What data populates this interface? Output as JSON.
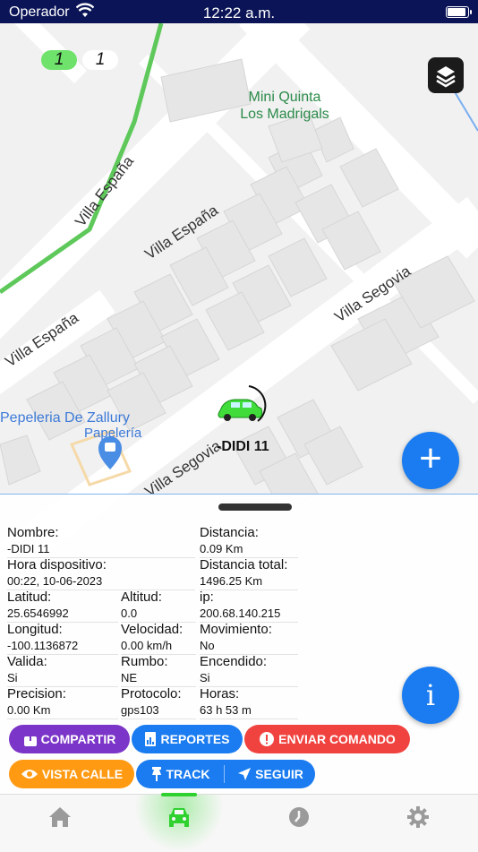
{
  "status_bar": {
    "carrier": "Operador",
    "time": "12:22 a.m.",
    "battery_level": 0.9
  },
  "map": {
    "counters": {
      "green": "1",
      "white": "1"
    },
    "poi": {
      "line1": "Mini Quinta",
      "line2": "Los Madrigals"
    },
    "shop": {
      "name": "Pepeleria De Zallury",
      "category": "Papelería"
    },
    "streets": [
      "Villa España",
      "Villa España",
      "Villa España",
      "Villa Segovia",
      "Villa Segovia"
    ],
    "vehicle_label": "-DIDI 11",
    "plus_label": "+",
    "info_label": "i"
  },
  "colors": {
    "accent": "#1a7cf0",
    "route": "#5ec95a",
    "vehicle": "#3fdc3a"
  },
  "details": {
    "nombre_lbl": "Nombre:",
    "nombre_val": "-DIDI 11",
    "hora_lbl": "Hora dispositivo:",
    "hora_val": "00:22, 10-06-2023",
    "latitud_lbl": "Latitud:",
    "latitud_val": "25.6546992",
    "altitud_lbl": "Altitud:",
    "altitud_val": "0.0",
    "longitud_lbl": "Longitud:",
    "longitud_val": "-100.1136872",
    "velocidad_lbl": "Velocidad:",
    "velocidad_val": "0.00 km/h",
    "valida_lbl": "Valida:",
    "valida_val": "Si",
    "rumbo_lbl": "Rumbo:",
    "rumbo_val": "NE",
    "precision_lbl": "Precision:",
    "precision_val": "0.00 Km",
    "protocolo_lbl": "Protocolo:",
    "protocolo_val": "gps103",
    "distancia_lbl": "Distancia:",
    "distancia_val": "0.09 Km",
    "distancia_total_lbl": "Distancia total:",
    "distancia_total_val": "1496.25 Km",
    "ip_lbl": "ip:",
    "ip_val": "200.68.140.215",
    "movimiento_lbl": "Movimiento:",
    "movimiento_val": "No",
    "encendido_lbl": "Encendido:",
    "encendido_val": "Si",
    "horas_lbl": "Horas:",
    "horas_val": "63 h 53 m"
  },
  "actions": {
    "compartir": "COMPARTIR",
    "reportes": "REPORTES",
    "enviar_comando": "ENVIAR COMANDO",
    "vista_calle": "VISTA CALLE",
    "track": "TRACK",
    "seguir": "SEGUIR"
  },
  "tabs": [
    {
      "icon": "home-icon"
    },
    {
      "icon": "car-icon",
      "active": true
    },
    {
      "icon": "history-icon"
    },
    {
      "icon": "settings-icon"
    }
  ]
}
